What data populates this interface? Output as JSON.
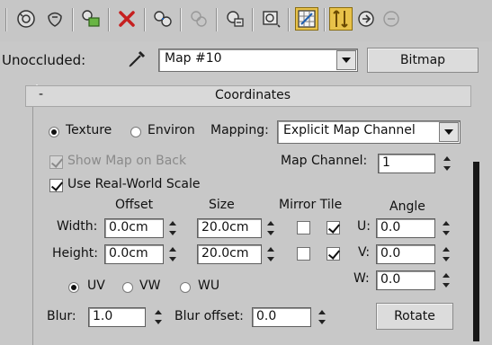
{
  "toolbar": {
    "icons": [
      "sample-type-sphere-icon",
      "backlight-icon",
      "material-slot-icon",
      "delete-icon",
      "make-unique-icon",
      "put-to-library-icon",
      "material-id-channel-icon",
      "show-shaded-icon",
      "show-map-in-viewport-icon",
      "show-end-result-icon",
      "go-to-parent-icon",
      "go-forward-sibling-icon"
    ],
    "active_color": "#e8c24a"
  },
  "map_row": {
    "label": "Unoccluded:",
    "map_name": "Map #10",
    "map_type": "Bitmap"
  },
  "rollout": {
    "collapse_symbol": "-",
    "title": "Coordinates"
  },
  "coords": {
    "texture_label": "Texture",
    "environ_label": "Environ",
    "mapping_label": "Mapping:",
    "mapping_value": "Explicit Map Channel",
    "show_map_on_back_label": "Show Map on Back",
    "map_channel_label": "Map Channel:",
    "map_channel_value": "1",
    "use_real_world_label": "Use Real-World Scale",
    "headers": {
      "offset": "Offset",
      "size": "Size",
      "mirror_tile": "Mirror Tile",
      "angle": "Angle"
    },
    "width_label": "Width:",
    "height_label": "Height:",
    "width_offset": "0.0cm",
    "width_size": "20.0cm",
    "height_offset": "0.0cm",
    "height_size": "20.0cm",
    "u_label": "U:",
    "v_label": "V:",
    "w_label": "W:",
    "u_angle": "0.0",
    "v_angle": "0.0",
    "w_angle": "0.0",
    "uv_label": "UV",
    "vw_label": "VW",
    "wu_label": "WU",
    "blur_label": "Blur:",
    "blur_value": "1.0",
    "blur_offset_label": "Blur offset:",
    "blur_offset_value": "0.0",
    "rotate_label": "Rotate"
  }
}
